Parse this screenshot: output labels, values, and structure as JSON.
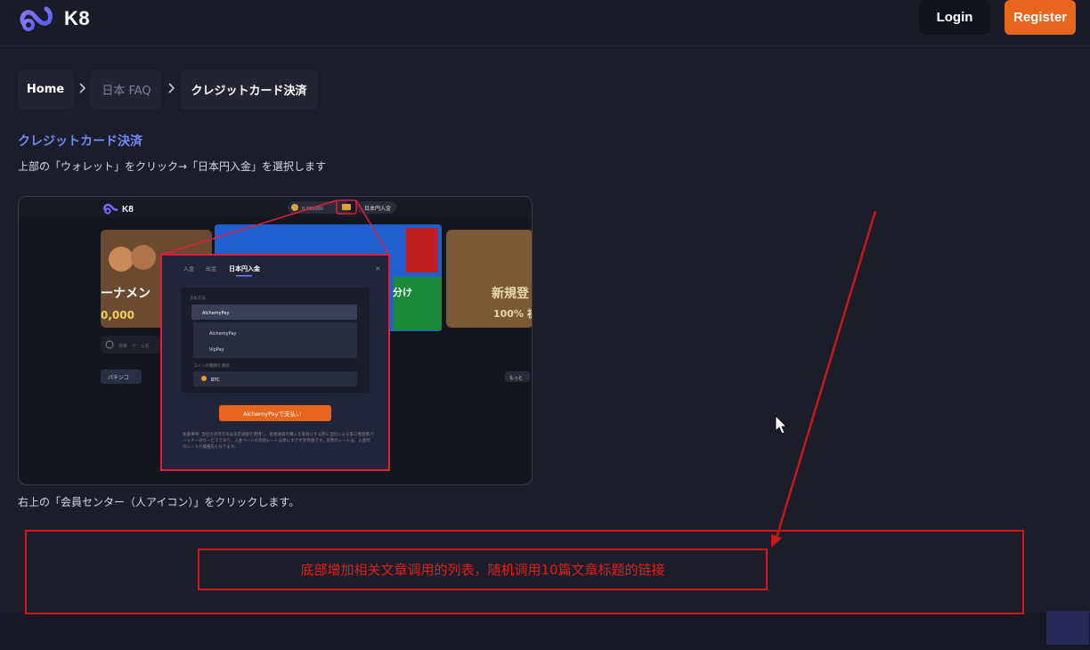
{
  "header": {
    "logo_text": "K8",
    "login_label": "Login",
    "register_label": "Register"
  },
  "breadcrumb": {
    "items": [
      "Home",
      "日本 FAQ",
      "クレジットカード決済"
    ]
  },
  "article": {
    "title": "クレジットカード決済",
    "step1": "上部の「ウォレット」をクリック→「日本円入金」を選択します",
    "step2": "右上の「会員センター（人アイコン）」をクリックします。"
  },
  "screenshot": {
    "logo_text": "K8",
    "balance": "0.000000",
    "deposit_label": "日本円入金",
    "banner_left_text": "ーナメン",
    "banner_left_value": "0,000",
    "banner_mid_text": "分け",
    "banner_right_text": "新規登",
    "banner_right_sub": "100% 初",
    "search_placeholder": "検索 · ゲーム名",
    "category_label": "パチンコ",
    "more_label": "もっと",
    "modal": {
      "tabs": [
        "入金",
        "出金",
        "日本円入金"
      ],
      "method_label": "支払方法",
      "selected_method": "AlchemyPay",
      "options": [
        "AlchemyPay",
        "VipPay"
      ],
      "coin_label": "コインの種類を選択",
      "coin": "BTC",
      "pay_button": "AlchemyPayで支払い",
      "notice": "免責事項: 当社の決済方法は法定通貨を使用し、仮想通貨の購入を容易にする際に当社による第三者提携パートナーのサービスであり、入金ページの為替レートは単にすぎず参考値です。実際のレートは、入金時のレートが最優先となります。"
    }
  },
  "annotation": {
    "text": "底部增加相关文章调用的列表，随机调用10篇文章标题的链接"
  },
  "colors": {
    "background": "#1b1d2b",
    "accent_orange": "#e8651e",
    "title_blue": "#6f8cf5",
    "annotation_red": "#d01818"
  }
}
